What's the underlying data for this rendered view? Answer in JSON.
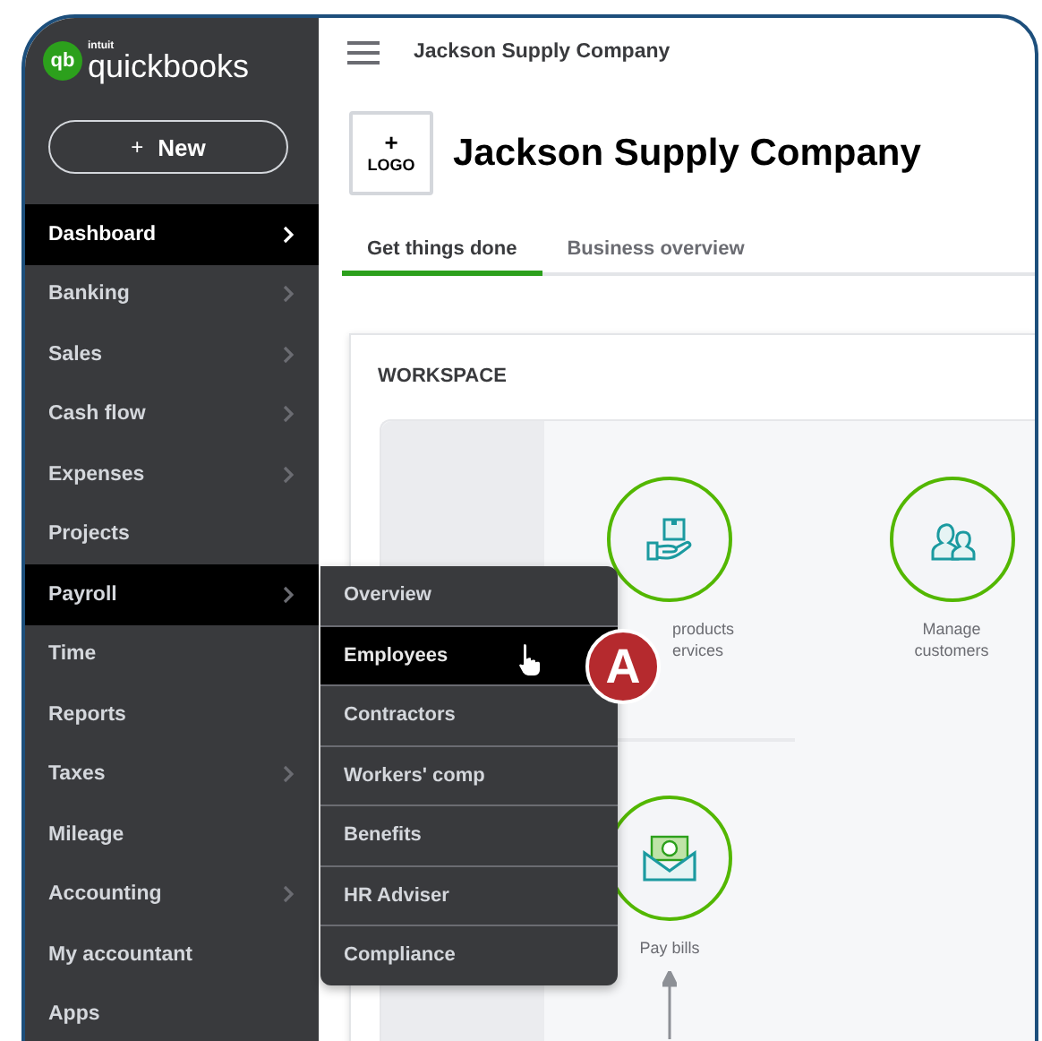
{
  "brand": {
    "mark": "qb",
    "company": "intuit",
    "product": "quickbooks"
  },
  "new_button": {
    "icon": "+",
    "label": "New"
  },
  "sidebar": {
    "items": [
      {
        "label": "Dashboard",
        "selected": true,
        "expanded": false,
        "chevron": true
      },
      {
        "label": "Banking",
        "selected": false,
        "expanded": false,
        "chevron": true
      },
      {
        "label": "Sales",
        "selected": false,
        "expanded": false,
        "chevron": true
      },
      {
        "label": "Cash flow",
        "selected": false,
        "expanded": false,
        "chevron": true
      },
      {
        "label": "Expenses",
        "selected": false,
        "expanded": false,
        "chevron": true
      },
      {
        "label": "Projects",
        "selected": false,
        "expanded": false,
        "chevron": false
      },
      {
        "label": "Payroll",
        "selected": false,
        "expanded": true,
        "chevron": true
      },
      {
        "label": "Time",
        "selected": false,
        "expanded": false,
        "chevron": false
      },
      {
        "label": "Reports",
        "selected": false,
        "expanded": false,
        "chevron": false
      },
      {
        "label": "Taxes",
        "selected": false,
        "expanded": false,
        "chevron": true
      },
      {
        "label": "Mileage",
        "selected": false,
        "expanded": false,
        "chevron": false
      },
      {
        "label": "Accounting",
        "selected": false,
        "expanded": false,
        "chevron": true
      },
      {
        "label": "My accountant",
        "selected": false,
        "expanded": false,
        "chevron": false
      },
      {
        "label": "Apps",
        "selected": false,
        "expanded": false,
        "chevron": false
      }
    ]
  },
  "submenu": {
    "items": [
      {
        "label": "Overview",
        "selected": false
      },
      {
        "label": "Employees",
        "selected": true
      },
      {
        "label": "Contractors",
        "selected": false
      },
      {
        "label": "Workers' comp",
        "selected": false
      },
      {
        "label": "Benefits",
        "selected": false
      },
      {
        "label": "HR Adviser",
        "selected": false
      },
      {
        "label": "Compliance",
        "selected": false
      }
    ]
  },
  "topbar": {
    "company": "Jackson Supply Company"
  },
  "header": {
    "logo_plus": "+",
    "logo_label": "LOGO",
    "title": "Jackson Supply Company"
  },
  "tabs": [
    {
      "label": "Get things done",
      "selected": true
    },
    {
      "label": "Business overview",
      "selected": false
    }
  ],
  "workspace": {
    "title": "WORKSPACE",
    "tasks": [
      {
        "kind": "products",
        "lines": [
          "products",
          "ervices"
        ]
      },
      {
        "kind": "customers",
        "lines": [
          "Manage",
          "customers"
        ]
      },
      {
        "kind": "bills",
        "lines": [
          "Pay bills"
        ]
      }
    ]
  },
  "annotation": {
    "label": "A"
  }
}
